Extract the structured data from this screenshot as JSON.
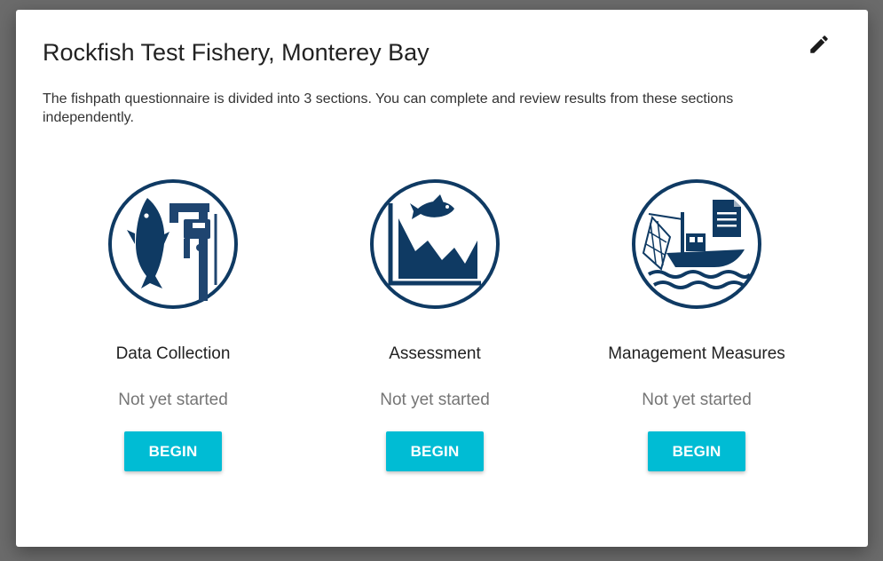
{
  "dialog": {
    "title": "Rockfish Test Fishery, Monterey Bay",
    "description": "The fishpath questionnaire is divided into 3 sections. You can complete and review results from these sections independently.",
    "edit_icon": "pencil-icon"
  },
  "sections": [
    {
      "name": "Data Collection",
      "status": "Not yet started",
      "button_label": "BEGIN",
      "icon": "fish-caliper-icon"
    },
    {
      "name": "Assessment",
      "status": "Not yet started",
      "button_label": "BEGIN",
      "icon": "fish-chart-icon"
    },
    {
      "name": "Management Measures",
      "status": "Not yet started",
      "button_label": "BEGIN",
      "icon": "fishing-boat-document-icon"
    }
  ],
  "colors": {
    "icon_navy": "#0f3a63",
    "button_cyan": "#00bcd4",
    "overlay_gray": "#6b6b6b"
  }
}
